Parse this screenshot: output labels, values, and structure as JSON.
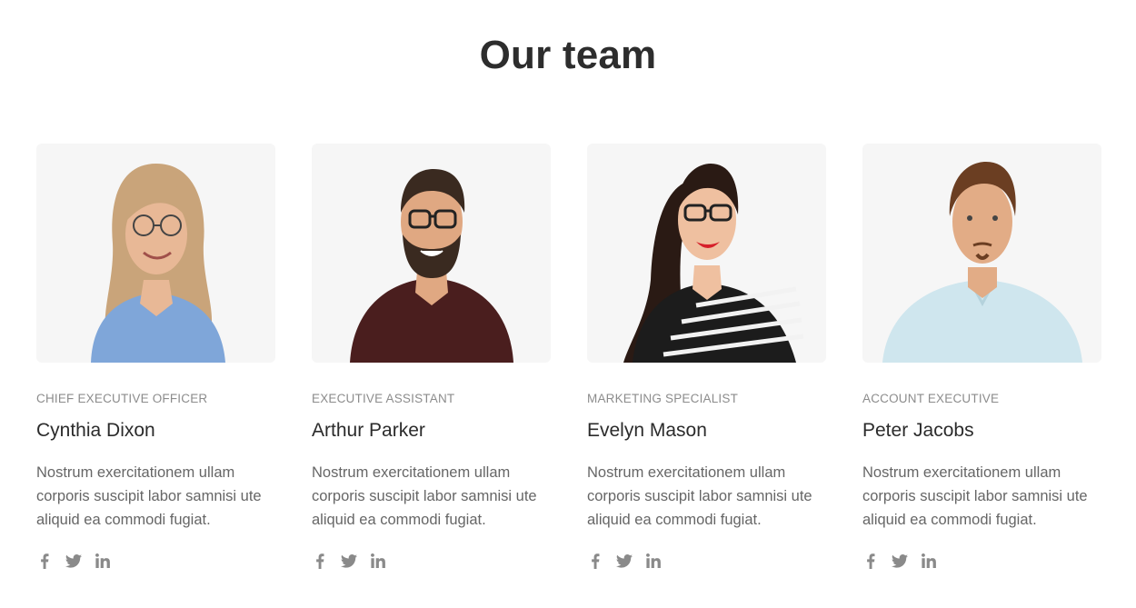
{
  "section": {
    "title": "Our team"
  },
  "members": [
    {
      "role": "CHIEF EXECUTIVE OFFICER",
      "name": "Cynthia Dixon",
      "bio": "Nostrum exercitationem ullam corporis suscipit labor samnisi ute aliquid ea commodi fugiat.",
      "hair": "#c9a47a",
      "shirt": "#7fa6d9"
    },
    {
      "role": "EXECUTIVE ASSISTANT",
      "name": "Arthur Parker",
      "bio": "Nostrum exercitationem ullam corporis suscipit labor samnisi ute aliquid ea commodi fugiat.",
      "hair": "#3a2a20",
      "shirt": "#4a1e1e"
    },
    {
      "role": "MARKETING SPECIALIST",
      "name": "Evelyn Mason",
      "bio": "Nostrum exercitationem ullam corporis suscipit labor samnisi ute aliquid ea commodi fugiat.",
      "hair": "#2a1a14",
      "shirt": "#1c1c1c"
    },
    {
      "role": "ACCOUNT EXECUTIVE",
      "name": "Peter Jacobs",
      "bio": "Nostrum exercitationem ullam corporis suscipit labor samnisi ute aliquid ea commodi fugiat.",
      "hair": "#6b3e22",
      "shirt": "#cfe6ee"
    }
  ],
  "social_icons": [
    "facebook-icon",
    "twitter-icon",
    "linkedin-icon"
  ],
  "colors": {
    "title": "#2d2d2d",
    "role": "#8c8c8c",
    "name": "#2b2b2b",
    "bio": "#666666",
    "icon": "#8a8a8a",
    "photo_bg": "#f6f6f6",
    "skin": "#e8b896"
  }
}
